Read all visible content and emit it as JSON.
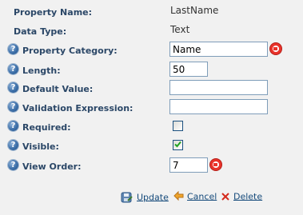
{
  "fields": {
    "property_name": {
      "label": "Property Name:",
      "value": "LastName"
    },
    "data_type": {
      "label": "Data Type:",
      "value": "Text"
    },
    "property_category": {
      "label": "Property Category:",
      "value": "Name",
      "required_indicator": true
    },
    "length": {
      "label": "Length:",
      "value": "50"
    },
    "default_value": {
      "label": "Default Value:",
      "value": ""
    },
    "validation_expression": {
      "label": "Validation Expression:",
      "value": ""
    },
    "required": {
      "label": "Required:",
      "checked": false
    },
    "visible": {
      "label": "Visible:",
      "checked": true
    },
    "view_order": {
      "label": "View Order:",
      "value": "7",
      "required_indicator": true
    }
  },
  "help_icon_glyph": "?",
  "actions": {
    "update": "Update",
    "cancel": "Cancel",
    "delete": "Delete"
  },
  "colors": {
    "label": "#2b4767",
    "link": "#14497a",
    "required_indicator": "#e9332b",
    "background": "#f1f1f1"
  }
}
